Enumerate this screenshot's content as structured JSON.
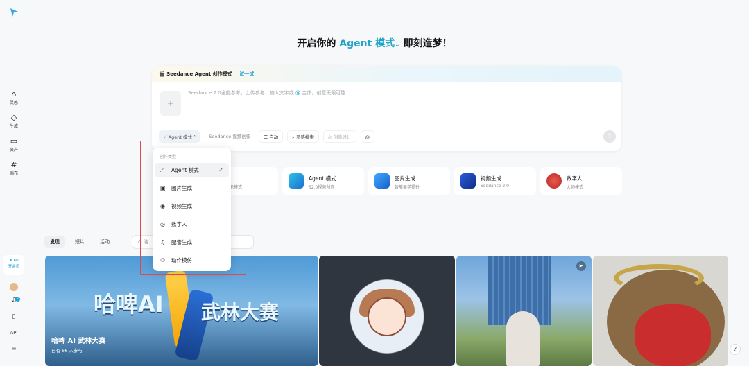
{
  "sidebar": {
    "items": [
      {
        "label": "灵感",
        "icon": "home-icon"
      },
      {
        "label": "生成",
        "icon": "diamond-icon"
      },
      {
        "label": "资产",
        "icon": "folder-icon"
      },
      {
        "label": "画布",
        "icon": "canvas-icon"
      }
    ],
    "upgrade_points": "✦ 60",
    "upgrade_label": "开会员",
    "notification_count": "2",
    "api_label": "API"
  },
  "headline": {
    "prefix": "开启你的 ",
    "mode": "Agent 模式",
    "suffix": " 即刻造梦！"
  },
  "composer": {
    "banner_title": "Seedance Agent 创作模式",
    "banner_try": "试一试",
    "upload_icon": "+",
    "prompt_placeholder_a": "Seedance 2.0全能参考，上传参考、输入文字或 ",
    "prompt_at": "@",
    "prompt_placeholder_b": " 主体，创意无限可能",
    "toolbar": {
      "mode": "Agent 模式",
      "seedance": "Seedance 视频创作",
      "auto": "自动",
      "inspiration": "灵感搜索",
      "creative": "创意设计",
      "mention": "@"
    }
  },
  "mode_cards": [
    {
      "title": "",
      "subtitle": "能模式"
    },
    {
      "title": "Agent 模式",
      "subtitle": "S2.0视频创作"
    },
    {
      "title": "图片生成",
      "subtitle": "智能美学提升"
    },
    {
      "title": "视频生成",
      "subtitle": "Seedance 2.0"
    },
    {
      "title": "数字人",
      "subtitle": "大师模式"
    }
  ],
  "feed": {
    "tabs": [
      "发现",
      "短片",
      "活动"
    ],
    "search_placeholder": "Q 油",
    "hero_title": "哈啤 AI 武林大赛",
    "hero_sub": "已有 66 人参与",
    "hero_art_left": "哈啤AI",
    "hero_art_right": "武林大赛"
  },
  "dropdown": {
    "header": "创作类型",
    "items": [
      {
        "label": "Agent 模式",
        "icon": "agent-icon",
        "selected": true
      },
      {
        "label": "图片生成",
        "icon": "image-icon",
        "selected": false
      },
      {
        "label": "视频生成",
        "icon": "video-icon",
        "selected": false
      },
      {
        "label": "数字人",
        "icon": "digital-human-icon",
        "selected": false
      },
      {
        "label": "配音生成",
        "icon": "music-icon",
        "selected": false
      },
      {
        "label": "动作模仿",
        "icon": "motion-icon",
        "selected": false
      }
    ]
  },
  "help": "?",
  "colors": {
    "accent": "#1fa3c9",
    "highlight_box": "#e2474f"
  }
}
